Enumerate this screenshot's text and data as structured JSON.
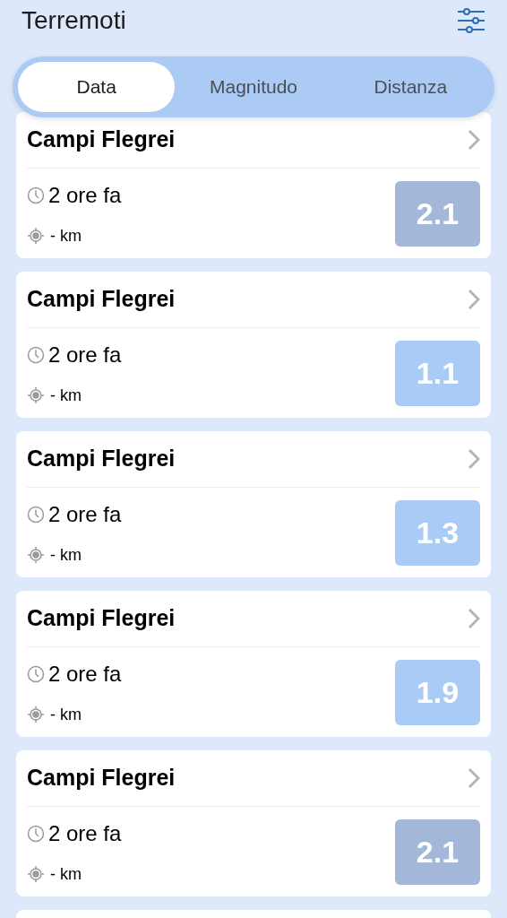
{
  "header": {
    "title": "Terremoti"
  },
  "tabs": [
    {
      "label": "Data",
      "selected": true
    },
    {
      "label": "Magnitudo",
      "selected": false
    },
    {
      "label": "Distanza",
      "selected": false
    }
  ],
  "events": [
    {
      "place": "Campi Flegrei",
      "time": "2 ore fa",
      "distance": "- km",
      "magnitude": "2.1",
      "color": "#a3b8d9"
    },
    {
      "place": "Campi Flegrei",
      "time": "2 ore fa",
      "distance": "- km",
      "magnitude": "1.1",
      "color": "#a9cbf5"
    },
    {
      "place": "Campi Flegrei",
      "time": "2 ore fa",
      "distance": "- km",
      "magnitude": "1.3",
      "color": "#a9cbf5"
    },
    {
      "place": "Campi Flegrei",
      "time": "2 ore fa",
      "distance": "- km",
      "magnitude": "1.9",
      "color": "#a9cbf5"
    },
    {
      "place": "Campi Flegrei",
      "time": "2 ore fa",
      "distance": "- km",
      "magnitude": "2.1",
      "color": "#a3b8d9"
    }
  ]
}
